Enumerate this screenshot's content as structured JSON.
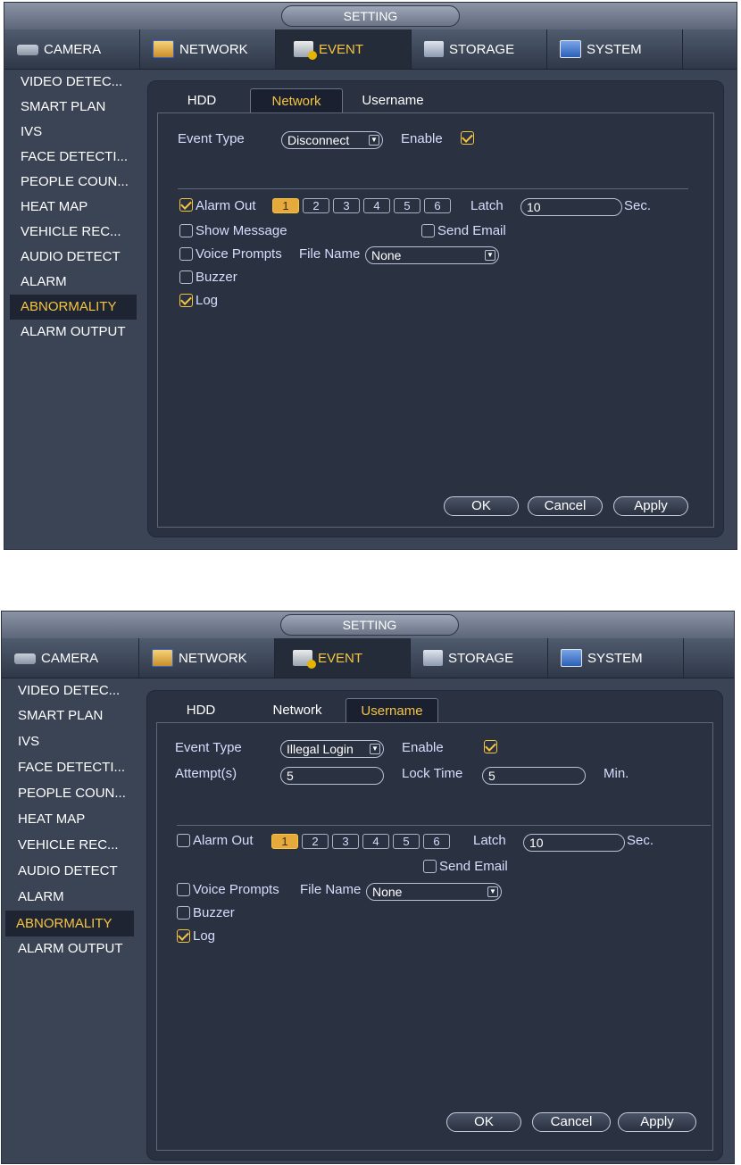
{
  "screens": [
    {
      "title": "SETTING",
      "main_tabs": [
        {
          "label": "CAMERA",
          "icon": "camera-icon"
        },
        {
          "label": "NETWORK",
          "icon": "network-icon"
        },
        {
          "label": "EVENT",
          "icon": "event-icon"
        },
        {
          "label": "STORAGE",
          "icon": "storage-icon"
        },
        {
          "label": "SYSTEM",
          "icon": "system-icon"
        }
      ],
      "active_main_tab": "EVENT",
      "sidebar": [
        "VIDEO DETEC...",
        "SMART PLAN",
        "IVS",
        "FACE DETECTI...",
        "PEOPLE COUN...",
        "HEAT MAP",
        "VEHICLE REC...",
        "AUDIO DETECT",
        "ALARM",
        "ABNORMALITY",
        "ALARM OUTPUT"
      ],
      "active_sidebar": "ABNORMALITY",
      "sub_tabs": [
        "HDD",
        "Network",
        "Username"
      ],
      "active_sub_tab": "Network",
      "form": {
        "event_type_label": "Event Type",
        "event_type_value": "Disconnect",
        "enable_label": "Enable",
        "enable_checked": true,
        "alarm_out_label": "Alarm Out",
        "alarm_out_checked": true,
        "alarm_channels": [
          "1",
          "2",
          "3",
          "4",
          "5",
          "6"
        ],
        "latch_label": "Latch",
        "latch_value": "10",
        "sec_label": "Sec.",
        "show_message_label": "Show Message",
        "show_message_checked": false,
        "send_email_label": "Send Email",
        "send_email_checked": false,
        "voice_prompts_label": "Voice Prompts",
        "voice_prompts_checked": false,
        "file_name_label": "File Name",
        "file_name_value": "None",
        "buzzer_label": "Buzzer",
        "buzzer_checked": false,
        "log_label": "Log",
        "log_checked": true
      },
      "buttons": {
        "ok": "OK",
        "cancel": "Cancel",
        "apply": "Apply"
      }
    },
    {
      "title": "SETTING",
      "main_tabs": [
        {
          "label": "CAMERA",
          "icon": "camera-icon"
        },
        {
          "label": "NETWORK",
          "icon": "network-icon"
        },
        {
          "label": "EVENT",
          "icon": "event-icon"
        },
        {
          "label": "STORAGE",
          "icon": "storage-icon"
        },
        {
          "label": "SYSTEM",
          "icon": "system-icon"
        }
      ],
      "active_main_tab": "EVENT",
      "sidebar": [
        "VIDEO DETEC...",
        "SMART PLAN",
        "IVS",
        "FACE DETECTI...",
        "PEOPLE COUN...",
        "HEAT MAP",
        "VEHICLE REC...",
        "AUDIO DETECT",
        "ALARM",
        "ABNORMALITY",
        "ALARM OUTPUT"
      ],
      "active_sidebar": "ABNORMALITY",
      "sub_tabs": [
        "HDD",
        "Network",
        "Username"
      ],
      "active_sub_tab": "Username",
      "form": {
        "event_type_label": "Event Type",
        "event_type_value": "Illegal Login",
        "enable_label": "Enable",
        "enable_checked": true,
        "attempts_label": "Attempt(s)",
        "attempts_value": "5",
        "lock_time_label": "Lock Time",
        "lock_time_value": "5",
        "min_label": "Min.",
        "alarm_out_label": "Alarm Out",
        "alarm_out_checked": false,
        "alarm_channels": [
          "1",
          "2",
          "3",
          "4",
          "5",
          "6"
        ],
        "latch_label": "Latch",
        "latch_value": "10",
        "sec_label": "Sec.",
        "send_email_label": "Send Email",
        "send_email_checked": false,
        "voice_prompts_label": "Voice Prompts",
        "voice_prompts_checked": false,
        "file_name_label": "File Name",
        "file_name_value": "None",
        "buzzer_label": "Buzzer",
        "buzzer_checked": false,
        "log_label": "Log",
        "log_checked": true
      },
      "buttons": {
        "ok": "OK",
        "cancel": "Cancel",
        "apply": "Apply"
      }
    }
  ]
}
